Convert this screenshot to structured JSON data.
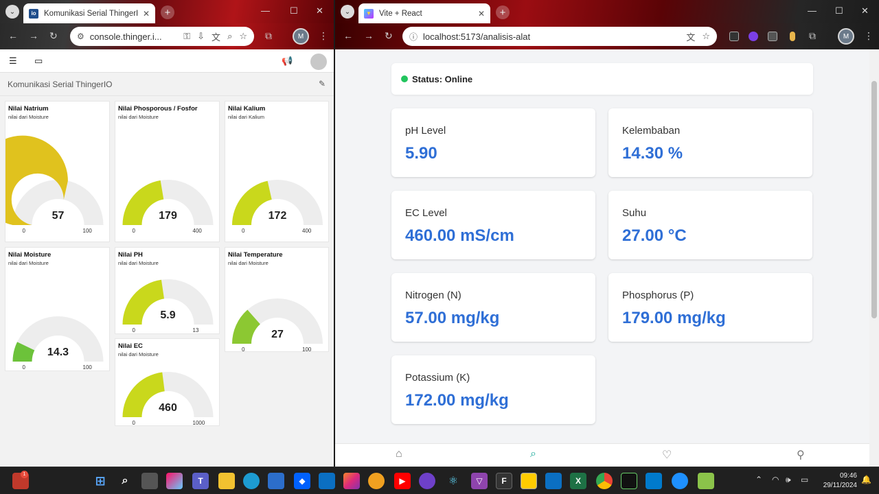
{
  "left_window": {
    "tab_title": "Komunikasi Serial ThingerIO",
    "favicon_text": "io",
    "url": "console.thinger.i...",
    "profile_initial": "M",
    "subheader_title": "Komunikasi Serial ThingerIO",
    "widgets": [
      {
        "title": "Nilai Natrium",
        "subtitle": "nilai dari Moisture",
        "value": "57",
        "min": "0",
        "max": "100",
        "fraction": 0.57,
        "color": "#e0c21e"
      },
      {
        "title": "Nilai Phosporous / Fosfor",
        "subtitle": "nilai dari Moisture",
        "value": "179",
        "min": "0",
        "max": "400",
        "fraction": 0.4475,
        "color": "#c9d81c"
      },
      {
        "title": "Nilai Kalium",
        "subtitle": "nilai dari Kalium",
        "value": "172",
        "min": "0",
        "max": "400",
        "fraction": 0.43,
        "color": "#c9d81c"
      },
      {
        "title": "Nilai Moisture",
        "subtitle": "nilai dari Moisture",
        "value": "14.3",
        "min": "0",
        "max": "100",
        "fraction": 0.143,
        "color": "#6cc23a"
      },
      {
        "title": "Nilai PH",
        "subtitle": "nilai dari Moisture",
        "value": "5.9",
        "min": "0",
        "max": "13",
        "fraction": 0.4538,
        "color": "#c9d81c"
      },
      {
        "title": "Nilai Temperature",
        "subtitle": "nilai dari Moisture",
        "value": "27",
        "min": "0",
        "max": "100",
        "fraction": 0.27,
        "color": "#8cc832"
      },
      {
        "title": "Nilai EC",
        "subtitle": "nilai dari Moisture",
        "value": "460",
        "min": "0",
        "max": "1000",
        "fraction": 0.46,
        "color": "#c9d81c"
      }
    ]
  },
  "right_window": {
    "tab_title": "Vite + React",
    "url": "localhost:5173/analisis-alat",
    "profile_initial": "M",
    "status_text": "Status: Online",
    "status_color": "#22c55e",
    "accent_color": "#2f6fd6",
    "cards": [
      {
        "label": "pH Level",
        "value": "5.90"
      },
      {
        "label": "Kelembaban",
        "value": "14.30 %"
      },
      {
        "label": "EC Level",
        "value": "460.00 mS/cm"
      },
      {
        "label": "Suhu",
        "value": "27.00 °C"
      },
      {
        "label": "Nitrogen (N)",
        "value": "57.00 mg/kg"
      },
      {
        "label": "Phosphorus (P)",
        "value": "179.00 mg/kg"
      },
      {
        "label": "Potassium (K)",
        "value": "172.00 mg/kg"
      }
    ],
    "nav_icons": [
      "home-icon",
      "search-icon",
      "heart-icon",
      "user-icon"
    ]
  },
  "taskbar": {
    "notification_badge": "1",
    "time": "09:46",
    "date": "29/11/2024"
  }
}
